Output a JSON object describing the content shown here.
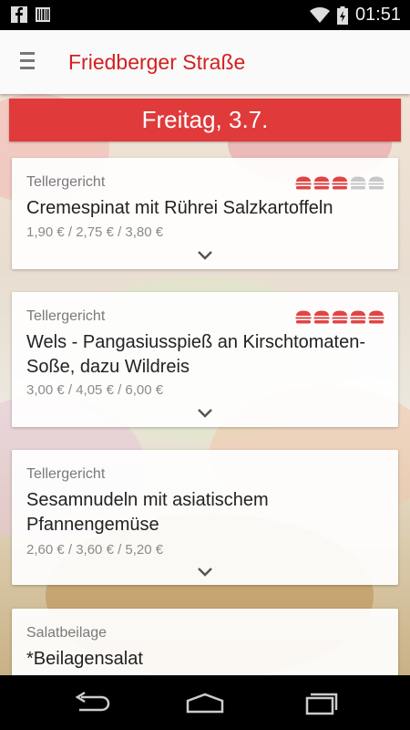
{
  "status_bar": {
    "time": "01:51",
    "icons": [
      "facebook-icon",
      "barcode-icon",
      "wifi-icon",
      "battery-charging-icon"
    ]
  },
  "app_bar": {
    "menu_icon": "hamburger-menu-icon",
    "title": "Friedberger Straße"
  },
  "date_header": "Freitag, 3.7.",
  "colors": {
    "accent": "#d42020",
    "date_bar": "#e03a3a",
    "rating_filled": "#e04545",
    "rating_empty": "#c8c8c8"
  },
  "meals": [
    {
      "category": "Tellergericht",
      "name": "Cremespinat mit Rührei Salzkartoffeln",
      "prices": "1,90 € / 2,75 € / 3,80 €",
      "rating": 3,
      "rating_max": 5
    },
    {
      "category": "Tellergericht",
      "name": "Wels - Pangasiusspieß an Kirschtomaten-Soße, dazu Wildreis",
      "prices": "3,00 € / 4,05 € / 6,00 €",
      "rating": 5,
      "rating_max": 5
    },
    {
      "category": "Tellergericht",
      "name": "Sesamnudeln mit asiatischem Pfannengemüse",
      "prices": "2,60 € / 3,60 € / 5,20 €",
      "rating": null,
      "rating_max": 5
    },
    {
      "category": "Salatbeilage",
      "name": "*Beilagensalat",
      "prices": "",
      "rating": null,
      "rating_max": 5
    }
  ],
  "nav_bar": {
    "icons": [
      "back-icon",
      "home-icon",
      "recent-apps-icon"
    ]
  }
}
